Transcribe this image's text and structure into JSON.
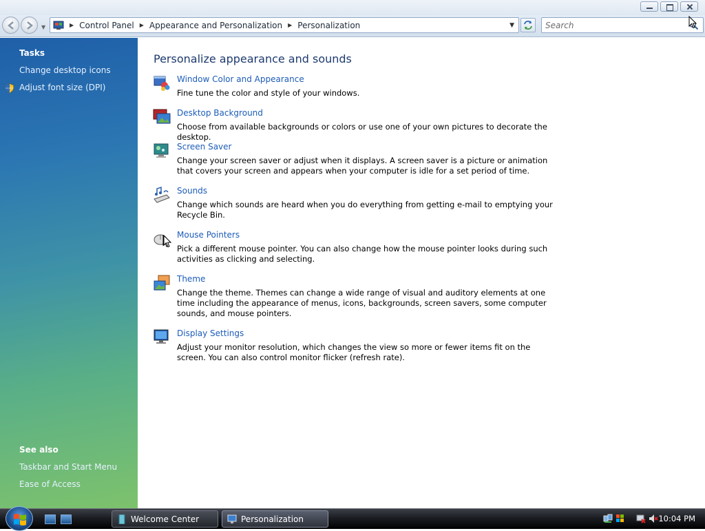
{
  "window": {
    "controls": [
      "minimize",
      "maximize",
      "close"
    ]
  },
  "address_bar": {
    "breadcrumbs": [
      "Control Panel",
      "Appearance and Personalization",
      "Personalization"
    ],
    "search_placeholder": "Search"
  },
  "task_pane": {
    "tasks_heading": "Tasks",
    "tasks": [
      {
        "label": "Change desktop icons",
        "icon": null
      },
      {
        "label": "Adjust font size (DPI)",
        "icon": "uac-shield-icon"
      }
    ],
    "see_also_heading": "See also",
    "see_also": [
      "Taskbar and Start Menu",
      "Ease of Access"
    ]
  },
  "main": {
    "title": "Personalize appearance and sounds",
    "items": [
      {
        "link": "Window Color and Appearance",
        "description": "Fine tune the color and style of your windows.",
        "icon": "window-color-icon"
      },
      {
        "link": "Desktop Background",
        "description": "Choose from available backgrounds or colors or use one of your own pictures to decorate the desktop.",
        "icon": "desktop-background-icon"
      },
      {
        "link": "Screen Saver",
        "description": "Change your screen saver or adjust when it displays. A screen saver is a picture or animation that covers your screen and appears when your computer is idle for a set period of time.",
        "icon": "screen-saver-icon"
      },
      {
        "link": "Sounds",
        "description": "Change which sounds are heard when you do everything from getting e-mail to emptying your Recycle Bin.",
        "icon": "sounds-icon"
      },
      {
        "link": "Mouse Pointers",
        "description": "Pick a different mouse pointer. You can also change how the mouse pointer looks during such activities as clicking and selecting.",
        "icon": "mouse-pointers-icon"
      },
      {
        "link": "Theme",
        "description": "Change the theme. Themes can change a wide range of visual and auditory elements at one time including the appearance of menus, icons, backgrounds, screen savers, some computer sounds, and mouse pointers.",
        "icon": "theme-icon"
      },
      {
        "link": "Display Settings",
        "description": "Adjust your monitor resolution, which changes the view so more or fewer items fit on the screen. You can also control monitor flicker (refresh rate).",
        "icon": "display-settings-icon"
      }
    ]
  },
  "taskbar": {
    "buttons": [
      {
        "label": "Welcome Center",
        "icon": "welcome-center-icon"
      },
      {
        "label": "Personalization",
        "icon": "personalization-icon"
      }
    ],
    "clock": "10:04 PM"
  },
  "colors": {
    "link": "#1c5cb8",
    "title": "#1d3a6e",
    "taskpane_top": "#1f5fa8",
    "taskpane_bottom": "#7dc26c"
  }
}
